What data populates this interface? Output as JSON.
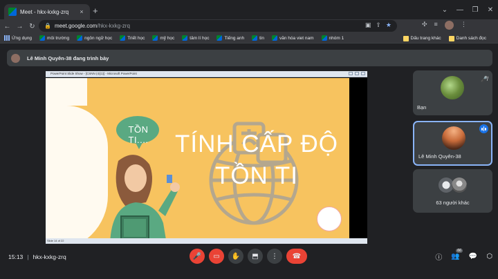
{
  "browser": {
    "tab_title": "Meet - hkx-kxkg-zrq",
    "tab_close": "×",
    "new_tab": "+",
    "window_controls": [
      "⌄",
      "—",
      "❐",
      "✕"
    ],
    "url_host": "meet.google.com",
    "url_path": "/hkx-kxkg-zrq",
    "nav": [
      "←",
      "→",
      "↻"
    ]
  },
  "bookmarks": [
    {
      "label": "Ứng dụng",
      "icon": "grid-icon"
    },
    {
      "label": "môi trường",
      "icon": "meet-icon"
    },
    {
      "label": "ngôn ngữ học",
      "icon": "meet-icon"
    },
    {
      "label": "Triết học",
      "icon": "meet-icon"
    },
    {
      "label": "mỹ học",
      "icon": "meet-icon"
    },
    {
      "label": "tâm lí học",
      "icon": "meet-icon"
    },
    {
      "label": "Tiếng anh",
      "icon": "meet-icon"
    },
    {
      "label": "tin",
      "icon": "meet-icon"
    },
    {
      "label": "văn hóa viet nam",
      "icon": "meet-icon"
    },
    {
      "label": "nhóm 1",
      "icon": "meet-icon"
    }
  ],
  "bookmarks_right": {
    "other": "Dấu trang khác",
    "reading_list": "Danh sách đọc"
  },
  "presenter": {
    "label": "Lê Minh Quyên-38 đang trình bày"
  },
  "presentation": {
    "window_title": "PowerPoint Slide Show - [CSNN (4)(1)] - Microsoft PowerPoint",
    "status": "Slide 14 of 22",
    "bubble_text": "TỒN TI....",
    "title_line1": "TÍNH CẤP ĐỘ",
    "title_line2": "TỒN TI"
  },
  "participants": [
    {
      "name": "Bạn",
      "muted": true
    },
    {
      "name": "Lê Minh Quyên-38",
      "speaking": true
    },
    {
      "name": "63 người khác"
    }
  ],
  "meeting": {
    "time": "15:13",
    "separator": "|",
    "code": "hkx-kxkg-zrq",
    "participant_count_badge": "66"
  },
  "colors": {
    "background": "#202124",
    "tile": "#3c4043",
    "slide_bg": "#f7c35f",
    "end_call": "#ea4335",
    "accent": "#8ab4f8"
  }
}
